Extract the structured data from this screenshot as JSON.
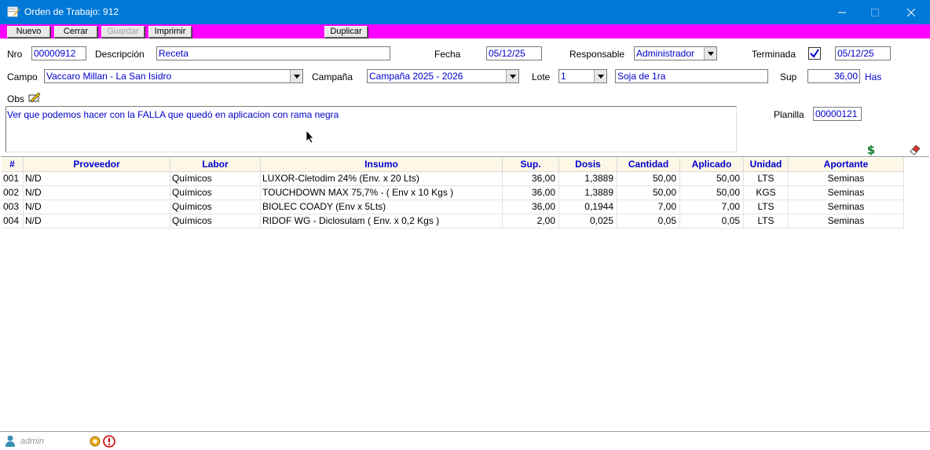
{
  "window": {
    "title": "Orden de Trabajo: 912"
  },
  "toolbar": {
    "nuevo": "Nuevo",
    "cerrar": "Cerrar",
    "guardar": "Guardar",
    "imprimir": "Imprimir",
    "duplicar": "Duplicar"
  },
  "form": {
    "nro_label": "Nro",
    "nro": "00000912",
    "descripcion_label": "Descripción",
    "descripcion": "Receta",
    "fecha_label": "Fecha",
    "fecha": "05/12/25",
    "responsable_label": "Responsable",
    "responsable": "Administrador",
    "terminada_label": "Terminada",
    "terminada_checked": true,
    "terminada_fecha": "05/12/25",
    "campo_label": "Campo",
    "campo": "Vaccaro Millan - La San Isidro",
    "campana_label": "Campaña",
    "campana": "Campaña 2025 - 2026",
    "lote_label": "Lote",
    "lote": "1",
    "lote_desc": "Soja de 1ra",
    "sup_label": "Sup",
    "sup": "36,00",
    "sup_unit": "Has",
    "obs_label": "Obs",
    "obs": "Ver que podemos hacer con la FALLA que quedó en aplicacion con rama negra",
    "planilla_label": "Planilla",
    "planilla": "00000121"
  },
  "grid": {
    "headers": [
      "#",
      "Proveedor",
      "Labor",
      "Insumo",
      "Sup.",
      "Dosis",
      "Cantidad",
      "Aplicado",
      "Unidad",
      "Aportante"
    ],
    "rows": [
      [
        "001",
        "N/D",
        "Químicos",
        "LUXOR-Cletodim 24% (Env. x 20 Lts)",
        "36,00",
        "1,3889",
        "50,00",
        "50,00",
        "LTS",
        "Seminas"
      ],
      [
        "002",
        "N/D",
        "Químicos",
        "TOUCHDOWN MAX 75,7% - ( Env x 10 Kgs )",
        "36,00",
        "1,3889",
        "50,00",
        "50,00",
        "KGS",
        "Seminas"
      ],
      [
        "003",
        "N/D",
        "Químicos",
        "BIOLEC COADY (Env x 5Lts)",
        "36,00",
        "0,1944",
        "7,00",
        "7,00",
        "LTS",
        "Seminas"
      ],
      [
        "004",
        "N/D",
        "Químicos",
        "RIDOF WG - Diclosulam ( Env. x 0,2 Kgs )",
        "2,00",
        "0,025",
        "0,05",
        "0,05",
        "LTS",
        "Seminas"
      ]
    ]
  },
  "status": {
    "user": "admin"
  },
  "colors": {
    "titlebar": "#0078d7",
    "toolbar": "#ff00ff",
    "value_text": "#0000cc",
    "grid_header_bg": "#fdf7e6"
  }
}
